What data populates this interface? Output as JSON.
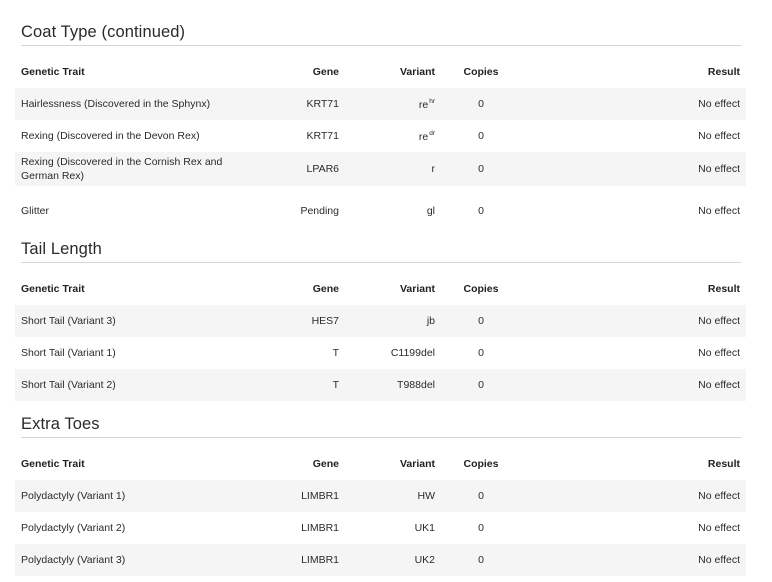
{
  "headers": {
    "trait": "Genetic Trait",
    "gene": "Gene",
    "variant": "Variant",
    "copies": "Copies",
    "result": "Result"
  },
  "sections": [
    {
      "title": "Coat Type (continued)",
      "rows": [
        {
          "trait": "Hairlessness (Discovered in the Sphynx)",
          "gene": "KRT71",
          "variant": "re",
          "variant_sup": "hr",
          "copies": "0",
          "result": "No effect"
        },
        {
          "trait": "Rexing (Discovered in the Devon Rex)",
          "gene": "KRT71",
          "variant": "re",
          "variant_sup": "dr",
          "copies": "0",
          "result": "No effect"
        },
        {
          "trait": "Rexing (Discovered in the Cornish Rex and German Rex)",
          "gene": "LPAR6",
          "variant": "r",
          "variant_sup": "",
          "copies": "0",
          "result": "No effect"
        },
        {
          "trait": "Glitter",
          "gene": "Pending",
          "variant": "gl",
          "variant_sup": "",
          "copies": "0",
          "result": "No effect"
        }
      ]
    },
    {
      "title": "Tail Length",
      "rows": [
        {
          "trait": "Short Tail (Variant 3)",
          "gene": "HES7",
          "variant": "jb",
          "variant_sup": "",
          "copies": "0",
          "result": "No effect"
        },
        {
          "trait": "Short Tail (Variant 1)",
          "gene": "T",
          "variant": "C1199del",
          "variant_sup": "",
          "copies": "0",
          "result": "No effect"
        },
        {
          "trait": "Short Tail (Variant 2)",
          "gene": "T",
          "variant": "T988del",
          "variant_sup": "",
          "copies": "0",
          "result": "No effect"
        }
      ]
    },
    {
      "title": "Extra Toes",
      "rows": [
        {
          "trait": "Polydactyly (Variant 1)",
          "gene": "LIMBR1",
          "variant": "HW",
          "variant_sup": "",
          "copies": "0",
          "result": "No effect"
        },
        {
          "trait": "Polydactyly (Variant 2)",
          "gene": "LIMBR1",
          "variant": "UK1",
          "variant_sup": "",
          "copies": "0",
          "result": "No effect"
        },
        {
          "trait": "Polydactyly (Variant 3)",
          "gene": "LIMBR1",
          "variant": "UK2",
          "variant_sup": "",
          "copies": "0",
          "result": "No effect"
        }
      ]
    }
  ]
}
